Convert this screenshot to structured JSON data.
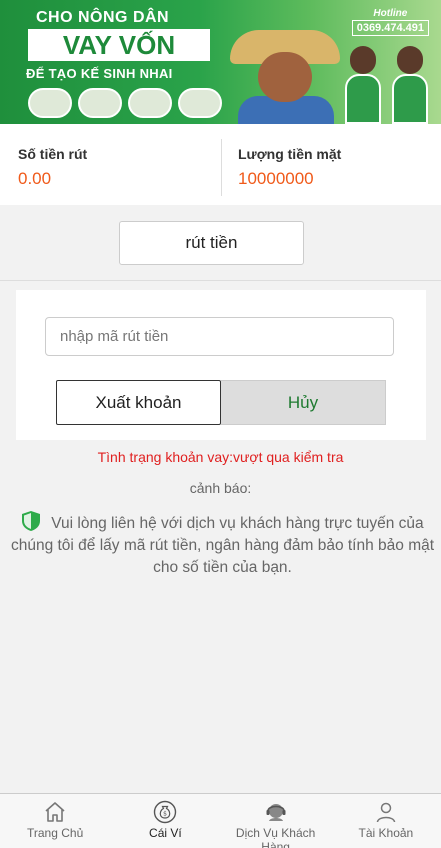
{
  "banner": {
    "line1": "CHO NÔNG DÂN",
    "line2": "VAY VỐN",
    "line3": "ĐỂ TẠO KẾ SINH NHAI",
    "hotline_label": "Hotline",
    "hotline_number": "0369.474.491"
  },
  "balance": {
    "withdraw_label": "Số tiền rút",
    "withdraw_value": "0.00",
    "cash_label": "Lượng tiền mặt",
    "cash_value": "10000000"
  },
  "withdraw_button": "rút tiền",
  "form": {
    "code_placeholder": "nhập mã rút tiền",
    "confirm_label": "Xuất khoản",
    "cancel_label": "Hủy"
  },
  "status_text": "Tình trạng khoản vay:vượt qua kiểm tra",
  "warning": {
    "title": "cảnh báo:",
    "text": "Vui lòng liên hệ với dịch vụ khách hàng trực tuyến của chúng tôi để lấy mã rút tiền, ngân hàng đảm bảo tính bảo mật cho số tiền của bạn."
  },
  "nav": {
    "items": [
      {
        "label": "Trang Chủ",
        "icon": "home-icon"
      },
      {
        "label": "Cái Ví",
        "icon": "money-bag-icon"
      },
      {
        "label": "Dịch Vụ Khách Hàng",
        "icon": "support-agent-icon"
      },
      {
        "label": "Tài Khoản",
        "icon": "user-icon"
      }
    ],
    "active_index": 1
  },
  "colors": {
    "accent_orange": "#f05a1a",
    "status_red": "#e02020",
    "brand_green": "#1e8a3a"
  }
}
